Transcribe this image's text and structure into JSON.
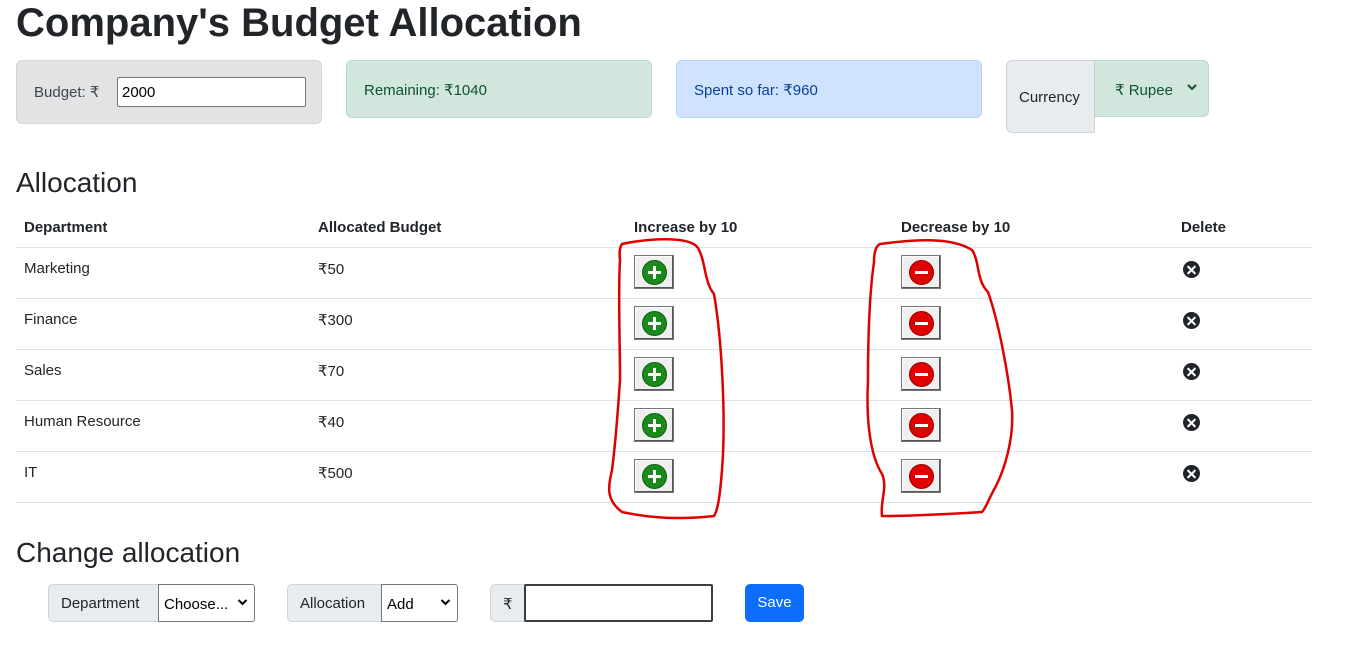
{
  "page": {
    "title": "Company's Budget Allocation"
  },
  "budget": {
    "label": "Budget: ₹",
    "value": "2000"
  },
  "remaining": {
    "text": "Remaining: ₹1040"
  },
  "spent": {
    "text": "Spent so far: ₹960"
  },
  "currency": {
    "label": "Currency",
    "selected": "₹ Rupee"
  },
  "allocation": {
    "heading": "Allocation",
    "columns": [
      "Department",
      "Allocated Budget",
      "Increase by 10",
      "Decrease by 10",
      "Delete"
    ],
    "rows": [
      {
        "department": "Marketing",
        "budget": "₹50"
      },
      {
        "department": "Finance",
        "budget": "₹300"
      },
      {
        "department": "Sales",
        "budget": "₹70"
      },
      {
        "department": "Human Resource",
        "budget": "₹40"
      },
      {
        "department": "IT",
        "budget": "₹500"
      }
    ]
  },
  "change": {
    "heading": "Change allocation",
    "department_label": "Department",
    "department_selected": "Choose...",
    "allocation_label": "Allocation",
    "allocation_selected": "Add",
    "currency_symbol": "₹",
    "amount_value": "",
    "save_label": "Save"
  },
  "icons": {
    "increase": "plus-circle-icon",
    "decrease": "minus-circle-icon",
    "delete": "x-circle-icon",
    "dropdown": "chevron-down-icon"
  },
  "colors": {
    "increase_icon": "#1a8a1a",
    "decrease_icon": "#e00000",
    "save_button": "#0d6efd",
    "remaining_bg": "#d1e7dd",
    "spent_bg": "#cfe2ff",
    "annotation": "#e00000"
  }
}
